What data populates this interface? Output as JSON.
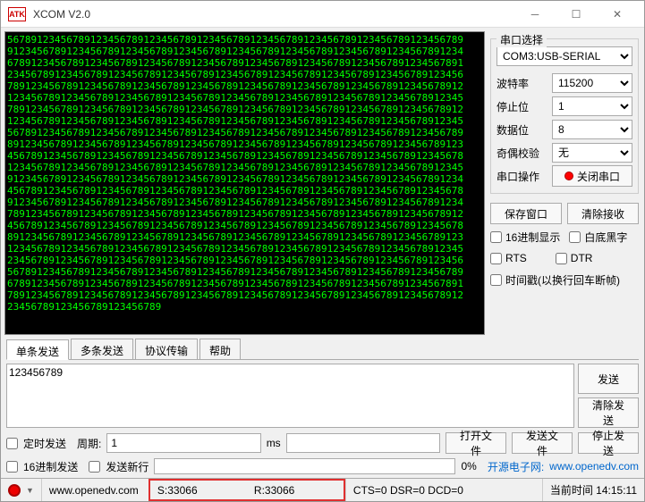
{
  "window": {
    "title": "XCOM V2.0",
    "icon_text": "ATK"
  },
  "terminal": {
    "content": "56789123456789123456789123456789123456789123456789123456789123456789123456789\n91234567891234567891234567891234567891234567891234567891234567891234567891234\n67891234567891234567891234567891234567891234567891234567891234567891234567891\n23456789123456789123456789123456789123456789123456789123456789123456789123456\n78912345678912345678912345678912345678912345678912345678912345678912345678912\n12345678912345678912345678912345678912345678912345678912345678912345678912345\n78912345678912345678912345678912345678912345678912345678912345678912345678912\n12345678912345678912345678912345678912345678912345678912345678912345678912345\n56789123456789123456789123456789123456789123456789123456789123456789123456789\n89123456789123456789123456789123456789123456789123456789123456789123456789123\n45678912345678912345678912345678912345678912345678912345678912345678912345678\n12345678912345678912345678912345678912345678912345678912345678912345678912345\n91234567891234567891234567891234567891234567891234567891234567891234567891234\n45678912345678912345678912345678912345678912345678912345678912345678912345678\n91234567891234567891234567891234567891234567891234567891234567891234567891234\n78912345678912345678912345678912345678912345678912345678912345678912345678912\n45678912345678912345678912345678912345678912345678912345678912345678912345678\n89123456789123456789123456789123456789123456789123456789123456789123456789123\n12345678912345678912345678912345678912345678912345678912345678912345678912345\n23456789123456789123456789123456789123456789123456789123456789123456789123456\n56789123456789123456789123456789123456789123456789123456789123456789123456789\n67891234567891234567891234567891234567891234567891234567891234567891234567891\n78912345678912345678912345678912345678912345678912345678912345678912345678912\n23456789123456789123456789"
  },
  "side": {
    "group_title": "串口选择",
    "port": "COM3:USB-SERIAL",
    "baud_label": "波特率",
    "baud": "115200",
    "stop_label": "停止位",
    "stop": "1",
    "data_label": "数据位",
    "data": "8",
    "parity_label": "奇偶校验",
    "parity": "无",
    "op_label": "串口操作",
    "op_btn": "关闭串口",
    "save_btn": "保存窗口",
    "clear_btn": "清除接收",
    "hex_disp": "16进制显示",
    "white_bg": "白底黑字",
    "rts": "RTS",
    "dtr": "DTR",
    "timestamp": "时间戳(以换行回车断帧)"
  },
  "tabs": {
    "t0": "单条发送",
    "t1": "多条发送",
    "t2": "协议传输",
    "t3": "帮助"
  },
  "send": {
    "text": "123456789",
    "send_btn": "发送",
    "clear_btn": "清除发送"
  },
  "row1": {
    "timed": "定时发送",
    "period_label": "周期:",
    "period": "1",
    "ms": "ms",
    "open": "打开文件",
    "sendfile": "发送文件",
    "stop": "停止发送"
  },
  "row2": {
    "hex_send": "16进制发送",
    "newline": "发送新行",
    "percent": "0%",
    "link_label": "开源电子网:",
    "link": "www.openedv.com"
  },
  "status": {
    "url": "www.openedv.com",
    "s": "S:33066",
    "r": "R:33066",
    "flags": "CTS=0 DSR=0 DCD=0",
    "time_label": "当前时间 14:15:11"
  }
}
